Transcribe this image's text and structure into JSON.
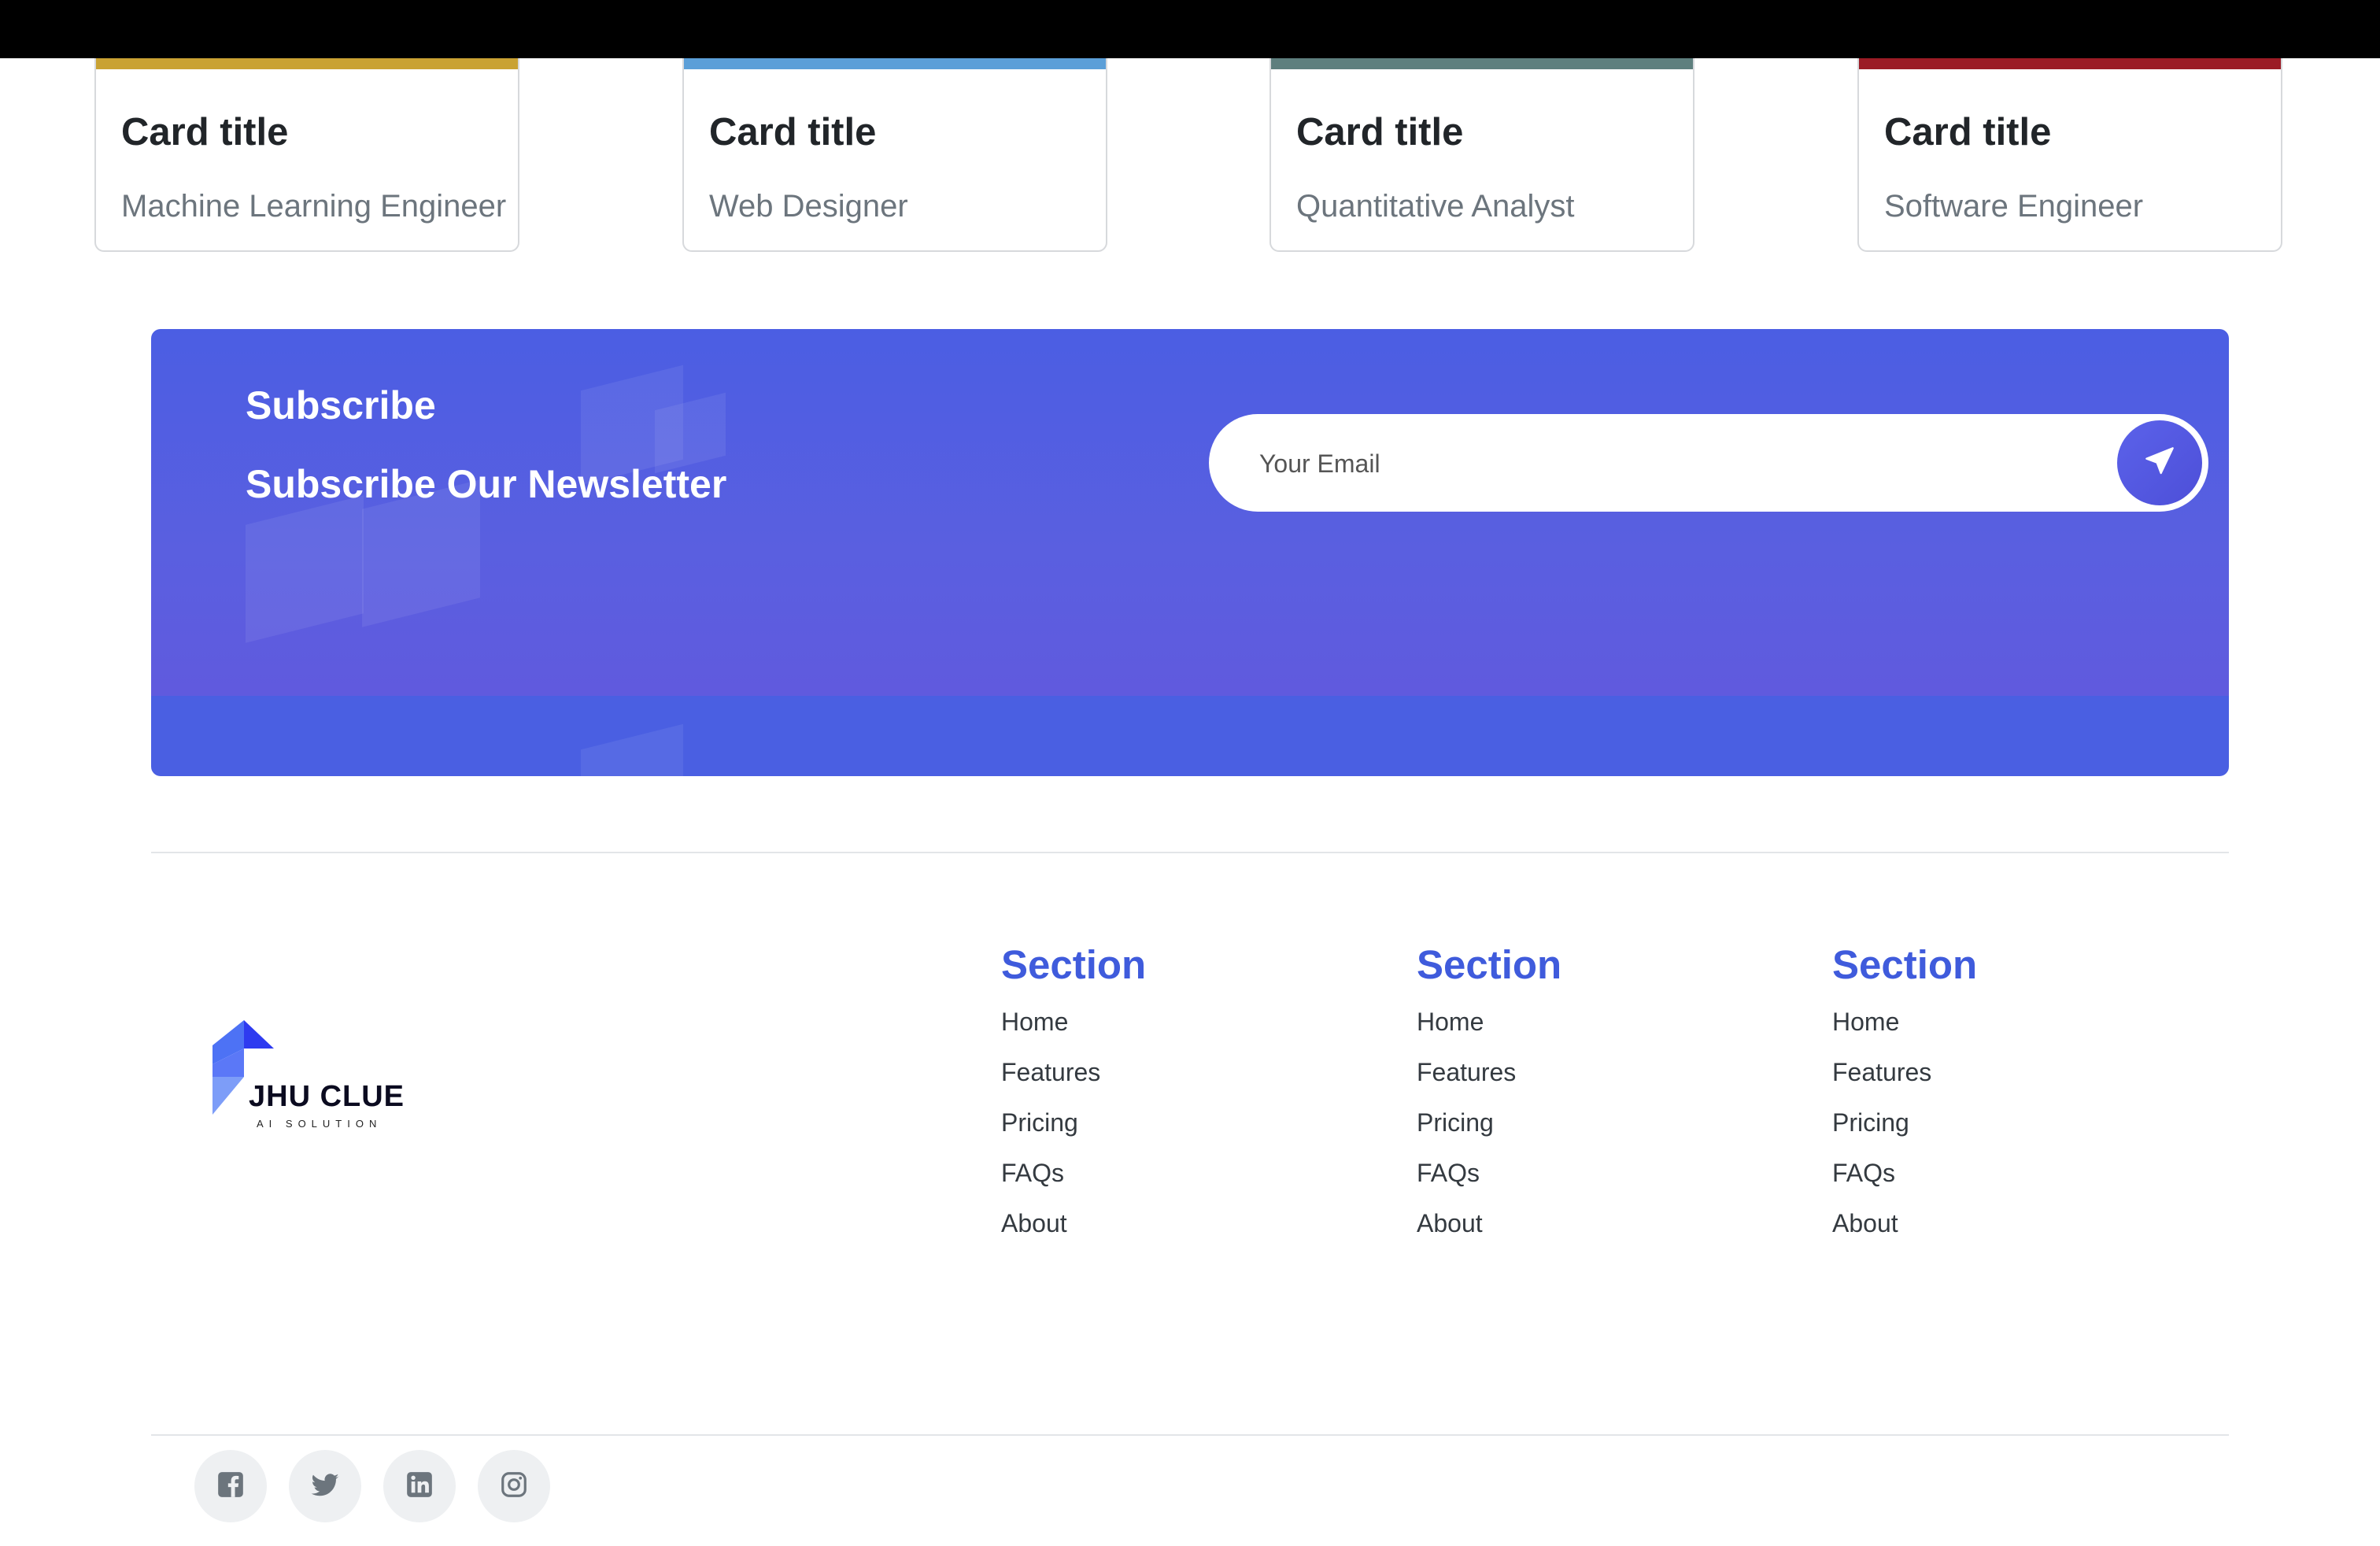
{
  "cards": [
    {
      "title": "Card title",
      "subtitle": "Machine Learning Engineer",
      "photo_color": "#c9a233"
    },
    {
      "title": "Card title",
      "subtitle": "Web Designer",
      "photo_color": "#5b9fd8"
    },
    {
      "title": "Card title",
      "subtitle": "Quantitative Analyst",
      "photo_color": "#5e7f7e"
    },
    {
      "title": "Card title",
      "subtitle": "Software Engineer",
      "photo_color": "#9b1b25"
    }
  ],
  "newsletter": {
    "title": "Subscribe",
    "subtitle": "Subscribe Our Newsletter",
    "email_placeholder": "Your Email",
    "send_icon": "paper-plane-icon",
    "background_color": "#4b5ee3"
  },
  "footer": {
    "brand": {
      "name": "JHU CLUE",
      "tagline": "AI SOLUTION",
      "logo_colors": [
        "#2e3bf0",
        "#4d72f5",
        "#7d9df8"
      ]
    },
    "sections": [
      {
        "heading": "Section",
        "links": [
          "Home",
          "Features",
          "Pricing",
          "FAQs",
          "About"
        ]
      },
      {
        "heading": "Section",
        "links": [
          "Home",
          "Features",
          "Pricing",
          "FAQs",
          "About"
        ]
      },
      {
        "heading": "Section",
        "links": [
          "Home",
          "Features",
          "Pricing",
          "FAQs",
          "About"
        ]
      }
    ],
    "heading_color": "#3f5bdc",
    "social": [
      "facebook-icon",
      "twitter-icon",
      "linkedin-icon",
      "instagram-icon"
    ]
  }
}
